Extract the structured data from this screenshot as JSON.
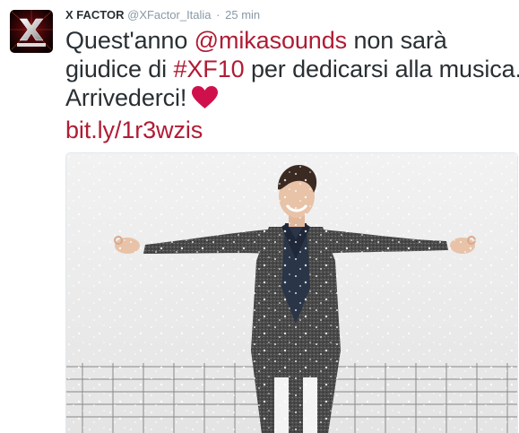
{
  "tweet": {
    "author_name": "X FACTOR",
    "author_handle": "@XFactor_Italia",
    "separator": "·",
    "timestamp": "25 min",
    "text": {
      "line1_prefix": "Quest'anno ",
      "mention": "@mikasounds",
      "line1_suffix": " non sarà",
      "line2_prefix": "giudice di ",
      "hashtag": "#XF10",
      "line2_suffix": " per dedicarsi alla musica.",
      "line3": "Arrivederci!",
      "link": "bit.ly/1r3wzis"
    },
    "emoji": "heart-icon"
  },
  "colors": {
    "accent": "#b01c34",
    "heart": "#d0104c",
    "name": "#292f33",
    "meta": "#8899a6"
  }
}
